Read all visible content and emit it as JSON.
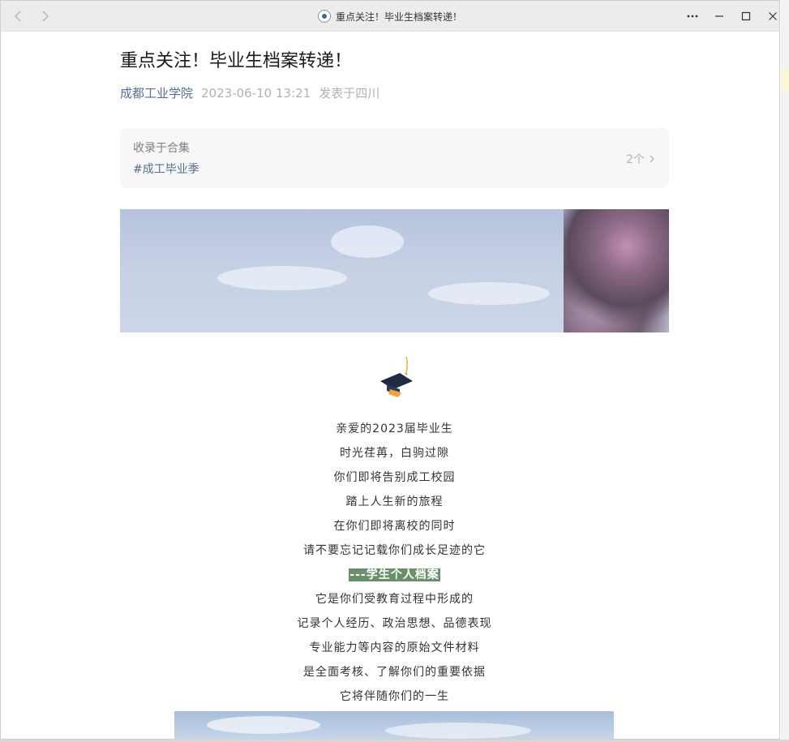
{
  "window": {
    "title": "重点关注！毕业生档案转递！"
  },
  "article": {
    "title": "重点关注！毕业生档案转递！",
    "author": "成都工业学院",
    "datetime": "2023-06-10 13:21",
    "location": "发表于四川",
    "album": {
      "label": "收录于合集",
      "tag": "#成工毕业季",
      "count": "2个"
    },
    "poem_before": [
      "亲爱的2023届毕业生",
      "时光荏苒，白驹过隙",
      "你们即将告别成工校园",
      "踏上人生新的旅程",
      "在你们即将离校的同时",
      "请不要忘记记载你们成长足迹的它"
    ],
    "highlight": "---学生个人档案",
    "poem_after": [
      "它是你们受教育过程中形成的",
      "记录个人经历、政治思想、品德表现",
      "专业能力等内容的原始文件材料",
      "是全面考核、了解你们的重要依据",
      "它将伴随你们的一生"
    ]
  },
  "colors": {
    "link": "#576b95",
    "muted": "#b2b2b2",
    "highlight_bg": "#6b8f6b"
  },
  "icons": {
    "back": "chevron-left-icon",
    "forward": "chevron-right-icon",
    "more": "more-icon",
    "minimize": "minimize-icon",
    "maximize": "maximize-icon",
    "close": "close-icon",
    "cap": "graduation-cap-icon"
  }
}
